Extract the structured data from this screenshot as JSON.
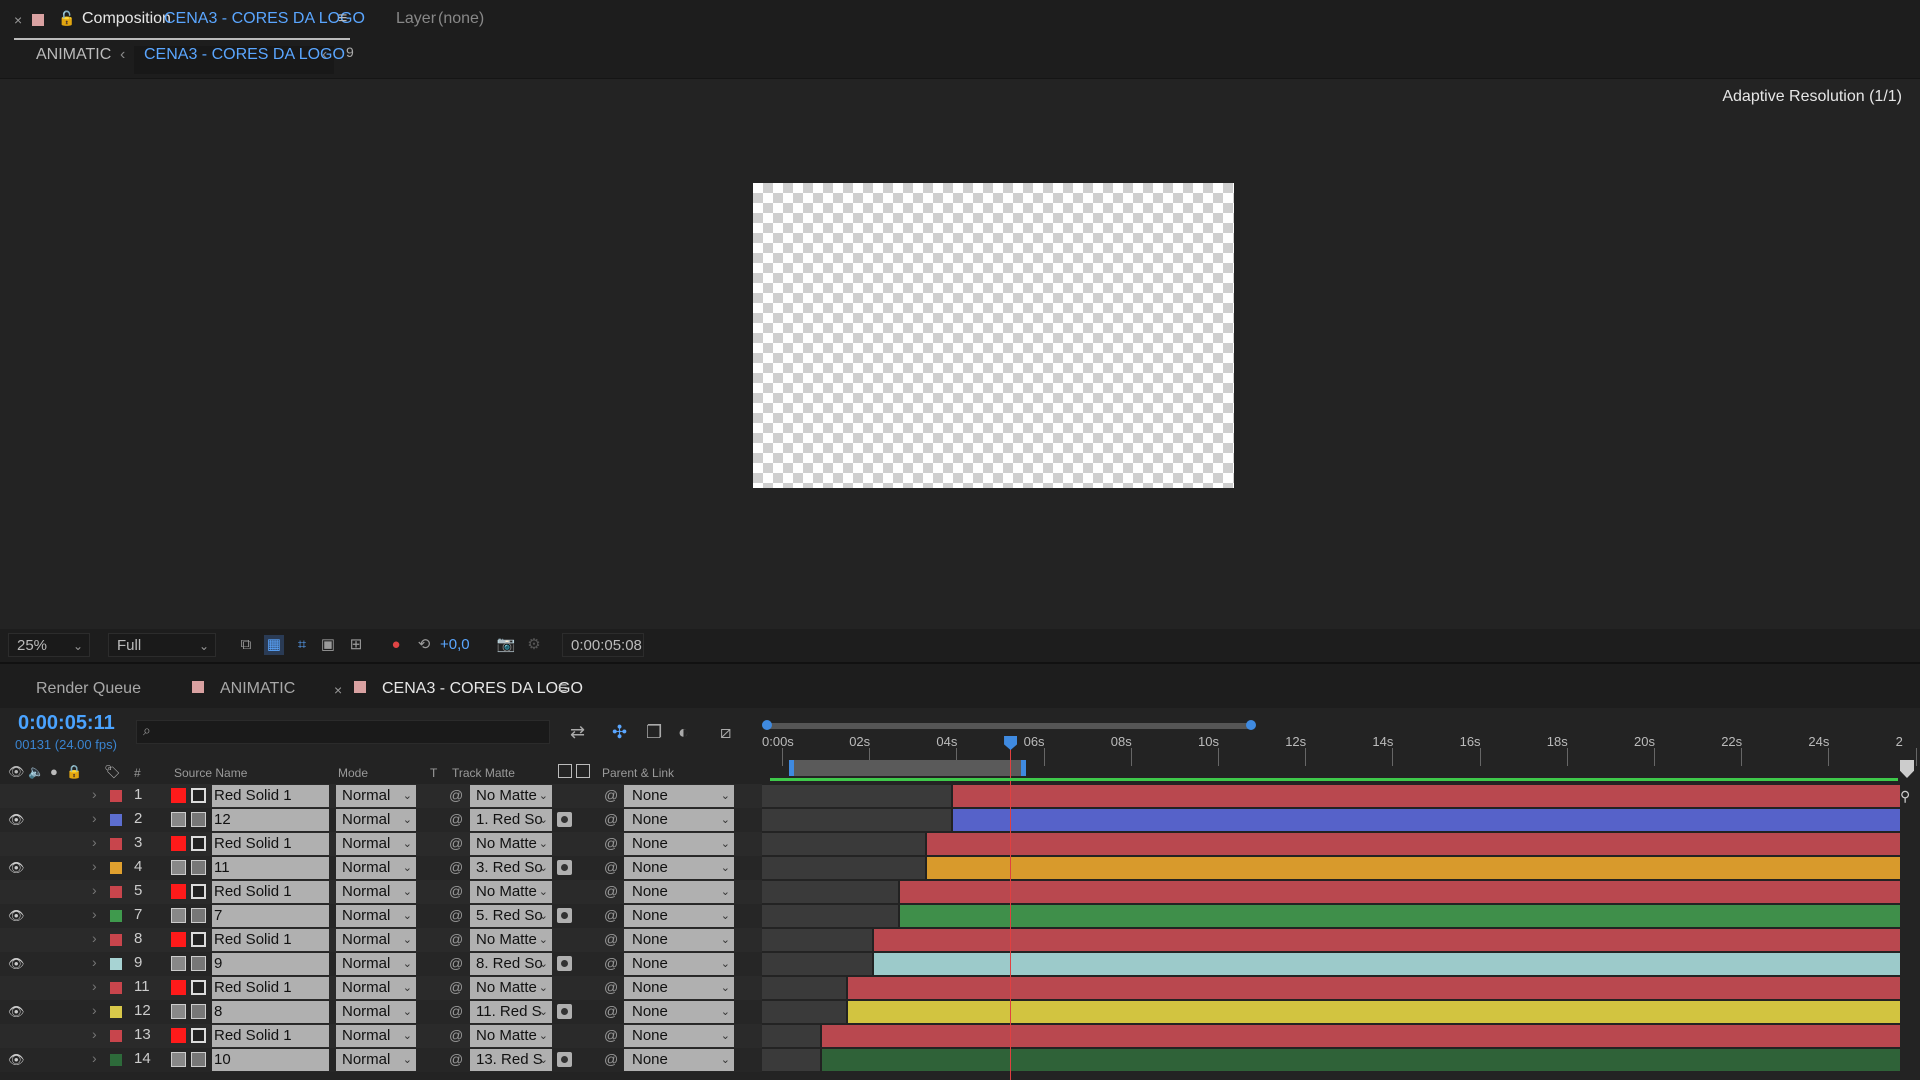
{
  "comp_panel": {
    "close": "×",
    "label": "Composition",
    "comp_name": "CENA3 - CORES DA LOGO",
    "menu": "≡",
    "layer_label": "Layer",
    "layer_value": "(none)",
    "breadcrumb": {
      "parent": "ANIMATIC",
      "current": "CENA3 - CORES DA LOGO",
      "count": "9"
    },
    "adaptive_resolution": "Adaptive Resolution (1/1)"
  },
  "viewer_toolbar": {
    "zoom": "25%",
    "resolution": "Full",
    "exposure": "+0,0",
    "timecode": "0:00:05:08"
  },
  "timeline_tabs": {
    "render_queue": "Render Queue",
    "animatic": "ANIMATIC",
    "close": "×",
    "comp": "CENA3 - CORES DA LOGO",
    "menu": "≡"
  },
  "timeline": {
    "current_time": "0:00:05:11",
    "frame_info": "00131 (24.00 fps)",
    "search_icon": "search-icon",
    "headers": {
      "hash": "#",
      "source_name": "Source Name",
      "mode": "Mode",
      "t": "T",
      "track_matte": "Track Matte",
      "parent": "Parent & Link"
    },
    "ruler": [
      "0:00s",
      "02s",
      "04s",
      "06s",
      "08s",
      "10s",
      "12s",
      "14s",
      "16s",
      "18s",
      "20s",
      "22s",
      "24s",
      "2"
    ],
    "seconds_total": 26,
    "playhead_seconds": 5.46,
    "work_area": {
      "start": 0.4,
      "end": 5.6
    },
    "layers": [
      {
        "num": "1",
        "name": "Red Solid 1",
        "type": "solid",
        "label_color": "#c8454c",
        "eye": false,
        "mode": "Normal",
        "matte": "No Matte",
        "has_matte_icon": false,
        "parent": "None",
        "bar_color": "#b9484f",
        "start": 4.1
      },
      {
        "num": "2",
        "name": "12",
        "type": "footage",
        "label_color": "#5c6ed0",
        "eye": true,
        "mode": "Normal",
        "matte": "1. Red So",
        "has_matte_icon": true,
        "parent": "None",
        "bar_color": "#5662c9",
        "start": 4.1
      },
      {
        "num": "3",
        "name": "Red Solid 1",
        "type": "solid",
        "label_color": "#c8454c",
        "eye": false,
        "mode": "Normal",
        "matte": "No Matte",
        "has_matte_icon": false,
        "parent": "None",
        "bar_color": "#b9484f",
        "start": 3.5
      },
      {
        "num": "4",
        "name": "11",
        "type": "footage",
        "label_color": "#e0a02e",
        "eye": true,
        "mode": "Normal",
        "matte": "3. Red So",
        "has_matte_icon": true,
        "parent": "None",
        "bar_color": "#d89a2c",
        "start": 3.5
      },
      {
        "num": "5",
        "name": "Red Solid 1",
        "type": "solid",
        "label_color": "#c8454c",
        "eye": false,
        "mode": "Normal",
        "matte": "No Matte",
        "has_matte_icon": false,
        "parent": "None",
        "bar_color": "#b9484f",
        "start": 2.9
      },
      {
        "num": "7",
        "name": "7",
        "type": "footage",
        "label_color": "#3f9a4d",
        "eye": true,
        "mode": "Normal",
        "matte": "5. Red So",
        "has_matte_icon": true,
        "parent": "None",
        "bar_color": "#3f8f4a",
        "start": 2.9
      },
      {
        "num": "8",
        "name": "Red Solid 1",
        "type": "solid",
        "label_color": "#c8454c",
        "eye": false,
        "mode": "Normal",
        "matte": "No Matte",
        "has_matte_icon": false,
        "parent": "None",
        "bar_color": "#b9484f",
        "start": 2.3
      },
      {
        "num": "9",
        "name": "9",
        "type": "footage",
        "label_color": "#a7d3d3",
        "eye": true,
        "mode": "Normal",
        "matte": "8. Red So",
        "has_matte_icon": true,
        "parent": "None",
        "bar_color": "#9ccaca",
        "start": 2.3
      },
      {
        "num": "11",
        "name": "Red Solid 1",
        "type": "solid",
        "label_color": "#c8454c",
        "eye": false,
        "mode": "Normal",
        "matte": "No Matte",
        "has_matte_icon": false,
        "parent": "None",
        "bar_color": "#b9484f",
        "start": 1.7
      },
      {
        "num": "12",
        "name": "8",
        "type": "footage",
        "label_color": "#d8c84a",
        "eye": true,
        "mode": "Normal",
        "matte": "11. Red S",
        "has_matte_icon": true,
        "parent": "None",
        "bar_color": "#d2c440",
        "start": 1.7
      },
      {
        "num": "13",
        "name": "Red Solid 1",
        "type": "solid",
        "label_color": "#c8454c",
        "eye": false,
        "mode": "Normal",
        "matte": "No Matte",
        "has_matte_icon": false,
        "parent": "None",
        "bar_color": "#b9484f",
        "start": 1.1
      },
      {
        "num": "14",
        "name": "10",
        "type": "footage",
        "label_color": "#2d6a3a",
        "eye": true,
        "mode": "Normal",
        "matte": "13. Red S",
        "has_matte_icon": true,
        "parent": "None",
        "bar_color": "#2f6238",
        "start": 1.1
      }
    ]
  }
}
